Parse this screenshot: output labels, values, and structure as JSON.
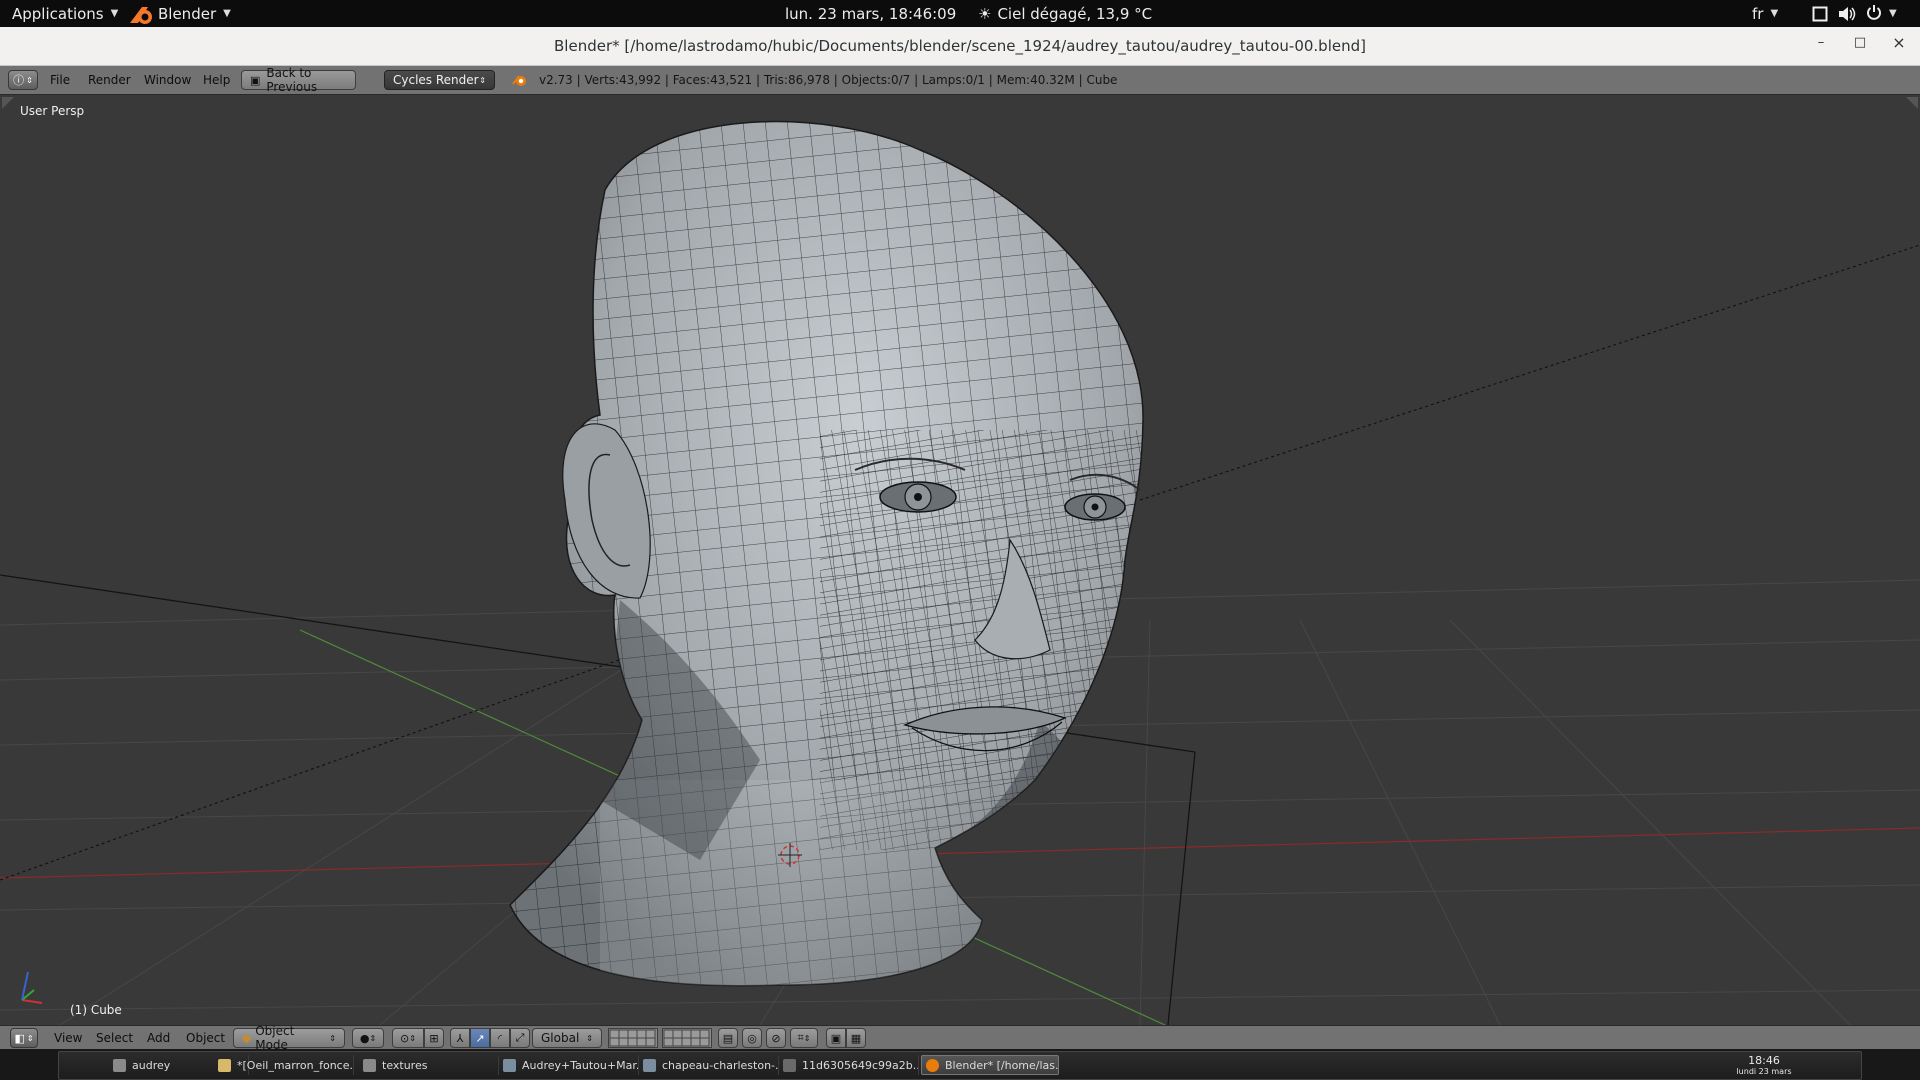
{
  "topbar": {
    "applications": "Applications",
    "app_name": "Blender",
    "datetime": "lun. 23 mars, 18:46:09",
    "weather": "Ciel dégagé, 13,9 °C",
    "language": "fr"
  },
  "window": {
    "title": "Blender* [/home/lastrodamo/hubic/Documents/blender/scene_1924/audrey_tautou/audrey_tautou-00.blend]",
    "minimize": "–",
    "maximize": "□",
    "close": "×"
  },
  "info_header": {
    "menus": [
      "File",
      "Render",
      "Window",
      "Help"
    ],
    "back_button": "Back to Previous",
    "render_engine": "Cycles Render",
    "stats": "v2.73 | Verts:43,992 | Faces:43,521 | Tris:86,978 | Objects:0/7 | Lamps:0/1 | Mem:40.32M | Cube"
  },
  "viewport": {
    "view_label": "User Persp",
    "object_label": "(1) Cube"
  },
  "view3d_header": {
    "menus": [
      "View",
      "Select",
      "Add",
      "Object"
    ],
    "mode": "Object Mode",
    "orientation": "Global"
  },
  "taskbar": {
    "tasks": [
      {
        "label": "audrey",
        "icon": "folder-icon"
      },
      {
        "label": "*[Oeil_marron_fonce...",
        "icon": "gimp-icon"
      },
      {
        "label": "textures",
        "icon": "folder-icon"
      },
      {
        "label": "Audrey+Tautou+Mar...",
        "icon": "image-icon"
      },
      {
        "label": "chapeau-charleston-...",
        "icon": "image-icon"
      },
      {
        "label": "11d6305649c99a2b...",
        "icon": "image-icon"
      },
      {
        "label": "Blender* [/home/las...",
        "icon": "blender-icon"
      }
    ],
    "clock_time": "18:46",
    "clock_date": "lundi 23 mars"
  },
  "colors": {
    "viewport_bg": "#393939",
    "header_bg": "#727272",
    "mesh": "#9ea3a8",
    "wire": "#111111",
    "x_axis": "#8b2a2a",
    "y_axis": "#4f8a3a"
  }
}
